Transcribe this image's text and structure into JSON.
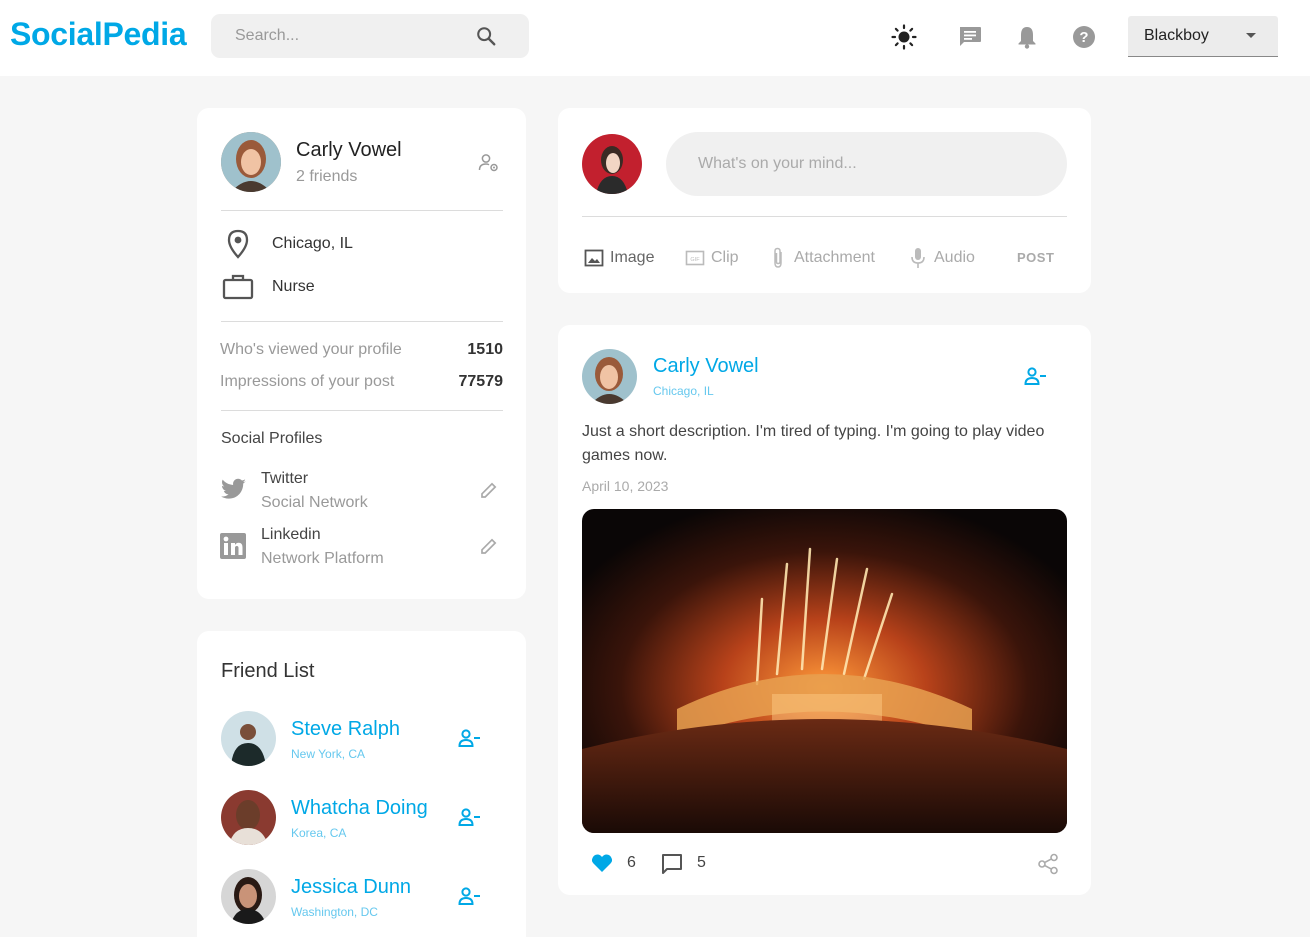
{
  "header": {
    "brand": "SocialPedia",
    "search_placeholder": "Search...",
    "user_name": "Blackboy"
  },
  "profile": {
    "name": "Carly Vowel",
    "friends": "2 friends",
    "location": "Chicago, IL",
    "occupation": "Nurse",
    "stats": [
      {
        "label": "Who's viewed your profile",
        "value": "1510"
      },
      {
        "label": "Impressions of your post",
        "value": "77579"
      }
    ],
    "social_title": "Social Profiles",
    "socials": [
      {
        "name": "Twitter",
        "sub": "Social Network"
      },
      {
        "name": "Linkedin",
        "sub": "Network Platform"
      }
    ]
  },
  "friends": {
    "title": "Friend List",
    "items": [
      {
        "name": "Steve Ralph",
        "location": "New York, CA"
      },
      {
        "name": "Whatcha Doing",
        "location": "Korea, CA"
      },
      {
        "name": "Jessica Dunn",
        "location": "Washington, DC"
      }
    ]
  },
  "composer": {
    "placeholder": "What's on your mind...",
    "actions": [
      "Image",
      "Clip",
      "Attachment",
      "Audio"
    ],
    "post_label": "POST"
  },
  "post": {
    "author": "Carly Vowel",
    "location": "Chicago, IL",
    "description": "Just a short description. I'm tired of typing. I'm going to play video games now.",
    "date": "April 10, 2023",
    "likes": "6",
    "comments": "5"
  },
  "colors": {
    "accent": "#00a8e6",
    "background": "#f6f6f6",
    "card": "#ffffff"
  }
}
